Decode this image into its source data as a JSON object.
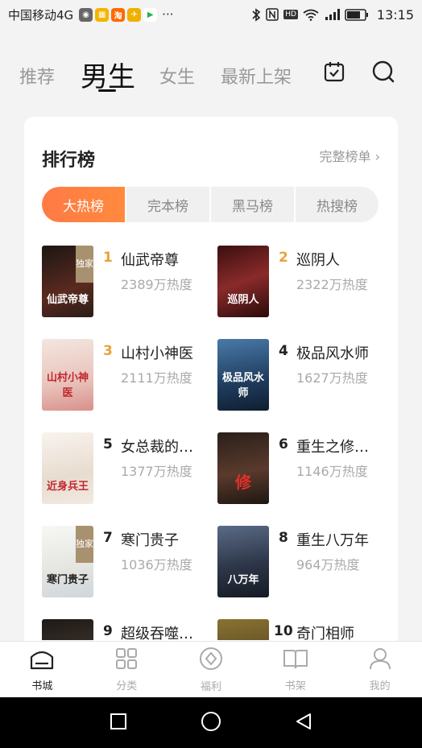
{
  "status_bar": {
    "carrier": "中国移动4G",
    "more": "···",
    "time": "13:15",
    "network_label": "HD"
  },
  "top_tabs": [
    {
      "label": "推荐"
    },
    {
      "label": "男生"
    },
    {
      "label": "女生"
    },
    {
      "label": "最新上架"
    }
  ],
  "card": {
    "title": "排行榜",
    "more_label": "完整榜单 ›",
    "segments": [
      {
        "label": "大热榜"
      },
      {
        "label": "完本榜"
      },
      {
        "label": "黑马榜"
      },
      {
        "label": "热搜榜"
      }
    ],
    "exclusive_badge": "独家",
    "books": [
      {
        "rank": "1",
        "name": "仙武帝尊",
        "heat": "2389万热度",
        "cover_text": "仙武帝尊",
        "cover_color": "#3a2a22"
      },
      {
        "rank": "2",
        "name": "巡阴人",
        "heat": "2322万热度",
        "cover_text": "巡阴人",
        "cover_color": "#5a1e1e"
      },
      {
        "rank": "3",
        "name": "山村小神医",
        "heat": "2111万热度",
        "cover_text": "山村小神医",
        "cover_color": "#e9c9c2"
      },
      {
        "rank": "4",
        "name": "极品风水师",
        "heat": "1627万热度",
        "cover_text": "极品风水师",
        "cover_color": "#2a4f7a"
      },
      {
        "rank": "5",
        "name": "女总裁的…",
        "heat": "1377万热度",
        "cover_text": "近身兵王",
        "cover_color": "#efe7df"
      },
      {
        "rank": "6",
        "name": "重生之修…",
        "heat": "1146万热度",
        "cover_text": "修",
        "cover_color": "#3a2b24"
      },
      {
        "rank": "7",
        "name": "寒门贵子",
        "heat": "1036万热度",
        "cover_text": "寒门贵子",
        "cover_color": "#f0f0ee"
      },
      {
        "rank": "8",
        "name": "重生八万年",
        "heat": "964万热度",
        "cover_text": "八万年",
        "cover_color": "#2d3648"
      },
      {
        "rank": "9",
        "name": "超级吞噬…",
        "heat": "",
        "cover_text": "",
        "cover_color": "#3b3128"
      },
      {
        "rank": "10",
        "name": "奇门相师",
        "heat": "",
        "cover_text": "",
        "cover_color": "#6b5a2a"
      }
    ]
  },
  "bottom_nav": [
    {
      "label": "书城",
      "icon": "bookstore-icon"
    },
    {
      "label": "分类",
      "icon": "category-icon"
    },
    {
      "label": "福利",
      "icon": "welfare-icon"
    },
    {
      "label": "书架",
      "icon": "bookshelf-icon"
    },
    {
      "label": "我的",
      "icon": "profile-icon"
    }
  ],
  "colors": {
    "accent": "#ff7a45",
    "rank_top": "#e8a23a",
    "exclusive_badge": "#a8916f"
  }
}
